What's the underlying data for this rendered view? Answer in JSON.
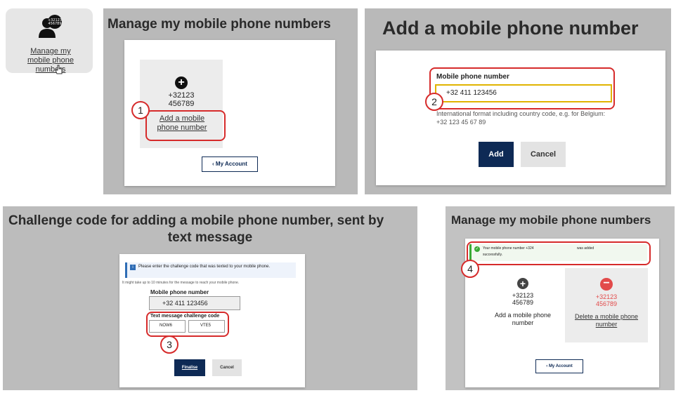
{
  "tile": {
    "phone_number_badge": "+32123\n456789",
    "label": "Manage my mobile phone numbers"
  },
  "panel1": {
    "title": "Manage my mobile phone numbers",
    "number_line1": "+32123",
    "number_line2": "456789",
    "add_link": "Add a mobile phone number",
    "my_account_button": "My Account",
    "step": "1"
  },
  "panel2": {
    "title": "Add a mobile phone number",
    "field_label": "Mobile phone number",
    "field_value": "+32 411 123456",
    "hint": "International format including country code, e.g. for Belgium: +32 123 45 67 89",
    "add_button": "Add",
    "cancel_button": "Cancel",
    "step": "2"
  },
  "panel3": {
    "title_line1": "Challenge code for adding a mobile phone number, sent by",
    "title_line2": "text message",
    "info": "Please enter the challenge code that was texted to your mobile phone.",
    "delay_note": "It might take up to 10 minutes for the message to reach your mobile phone.",
    "number_label": "Mobile phone number",
    "number_value": "+32 411 123456",
    "code_label": "Text message challenge code",
    "code_part1": "NOW6",
    "code_part2": "VTE5",
    "finalise_button": "Finalise",
    "cancel_button": "Cancel",
    "step": "3"
  },
  "panel4": {
    "title": "Manage my mobile phone numbers",
    "success_line1": "Your mobile phone number +324",
    "success_line1b": "was added",
    "success_line2": "successfully.",
    "number_line1": "+32123",
    "number_line2": "456789",
    "add_link": "Add a mobile phone number",
    "delete_link": "Delete a mobile phone number",
    "my_account_button": "My Account",
    "step": "4"
  },
  "colors": {
    "panel_bg": "#b9b9b9",
    "highlight": "#d62b2b",
    "primary_button": "#0e2a55",
    "delete_icon": "#e24a4a",
    "success": "#3aaa35",
    "field_border": "#e0b400"
  }
}
